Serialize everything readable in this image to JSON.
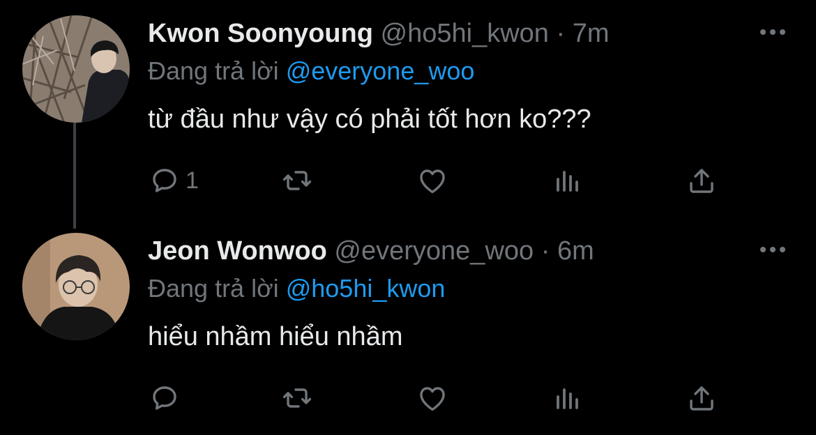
{
  "colors": {
    "background": "#000000",
    "primary_text": "#e7e9ea",
    "secondary_text": "#71767b",
    "accent": "#1d9bf0",
    "thread_line": "#3d4146"
  },
  "tweets": [
    {
      "display_name": "Kwon Soonyoung",
      "handle": "@ho5hi_kwon",
      "separator": "·",
      "time": "7m",
      "reply_prefix": "Đang trả lời",
      "reply_to": "@everyone_woo",
      "text": "từ đầu như vậy có phải tốt hơn ko???",
      "reply_count": "1",
      "avatar_icon": "avatar-photo",
      "more_icon": "more-horizontal-icon"
    },
    {
      "display_name": "Jeon Wonwoo",
      "handle": "@everyone_woo",
      "separator": "·",
      "time": "6m",
      "reply_prefix": "Đang trả lời",
      "reply_to": "@ho5hi_kwon",
      "text": "hiểu nhầm hiểu nhầm",
      "reply_count": "",
      "avatar_icon": "avatar-photo",
      "more_icon": "more-horizontal-icon"
    }
  ],
  "action_icons": [
    "reply-icon",
    "retweet-icon",
    "like-icon",
    "views-icon",
    "share-icon"
  ]
}
